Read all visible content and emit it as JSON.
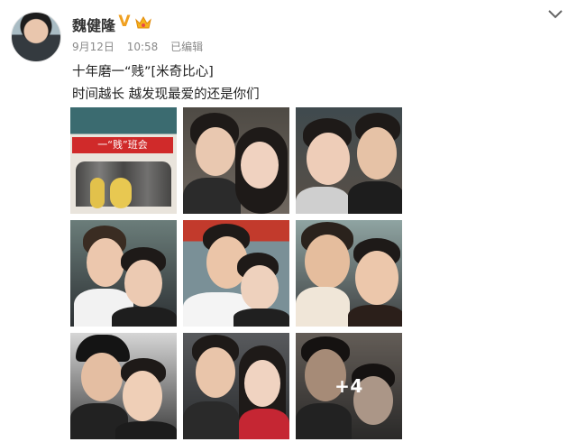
{
  "post": {
    "username": "魏健隆",
    "verified_icon": "verified-v-icon",
    "member_icon": "vip-crown-icon",
    "date": "9月12日",
    "time": "10:58",
    "edited": "已编辑",
    "text_line1": "十年磨一“贱”[米奇比心]",
    "text_line2": "时间越长 越发现最爱的还是你们",
    "menu_icon": "chevron-down-icon"
  },
  "photos": {
    "banner_text": "一“贱”班会",
    "more_count": "+4",
    "items": [
      "photo-1",
      "photo-2",
      "photo-3",
      "photo-4",
      "photo-5",
      "photo-6",
      "photo-7",
      "photo-8",
      "photo-9"
    ]
  },
  "colors": {
    "badge_orange": "#f0a020",
    "meta_gray": "#8a8a8a",
    "banner_red": "#d02a2a"
  }
}
